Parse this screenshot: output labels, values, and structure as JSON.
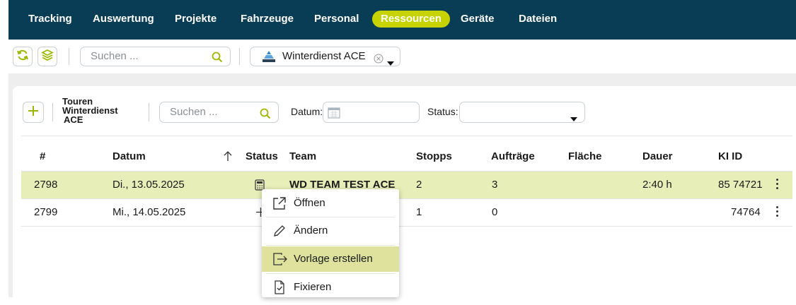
{
  "nav": {
    "items": [
      {
        "label": "Tracking"
      },
      {
        "label": "Auswertung"
      },
      {
        "label": "Projekte"
      },
      {
        "label": "Fahrzeuge"
      },
      {
        "label": "Personal"
      },
      {
        "label": "Ressourcen",
        "active": true
      },
      {
        "label": "Geräte"
      },
      {
        "label": "Dateien"
      }
    ]
  },
  "toolbar": {
    "search_placeholder": "Suchen ...",
    "project_filter": "Winterdienst ACE",
    "icons": [
      "refresh-icon",
      "layers-icon",
      "search-icon",
      "project-icon",
      "clear-icon",
      "chevron-down-icon"
    ]
  },
  "panel": {
    "title_line1": "Touren",
    "title_line2": "Winterdienst",
    "title_line3": "ACE",
    "search_placeholder": "Suchen ...",
    "date_label": "Datum:",
    "status_label": "Status:",
    "status_value": ""
  },
  "table": {
    "headers": {
      "num": "#",
      "date": "Datum",
      "status": "Status",
      "team": "Team",
      "stops": "Stopps",
      "orders": "Aufträge",
      "area": "Fläche",
      "duration": "Dauer",
      "kid": "KI ID"
    },
    "rows": [
      {
        "num": "2798",
        "date": "Di., 13.05.2025",
        "team": "WD TEAM TEST ACE",
        "stops": "2",
        "orders": "3",
        "area": "",
        "duration": "2:40 h",
        "kid": "85 74721"
      },
      {
        "num": "2799",
        "date": "Mi., 14.05.2025",
        "team": "",
        "stops": "1",
        "orders": "0",
        "area": "",
        "duration": "",
        "kid": "74764"
      }
    ]
  },
  "context_menu": {
    "items": [
      {
        "label": "Öffnen",
        "icon": "open-external-icon"
      },
      {
        "label": "Ändern",
        "icon": "pencil-icon"
      },
      {
        "label": "Vorlage erstellen",
        "icon": "template-export-icon",
        "highlighted": true
      },
      {
        "label": "Fixieren",
        "icon": "document-check-icon"
      }
    ]
  },
  "colors": {
    "nav_bg": "#083d55",
    "accent": "#c6d300",
    "row_highlight": "#e8eeb8",
    "menu_highlight": "#dfe29c"
  }
}
